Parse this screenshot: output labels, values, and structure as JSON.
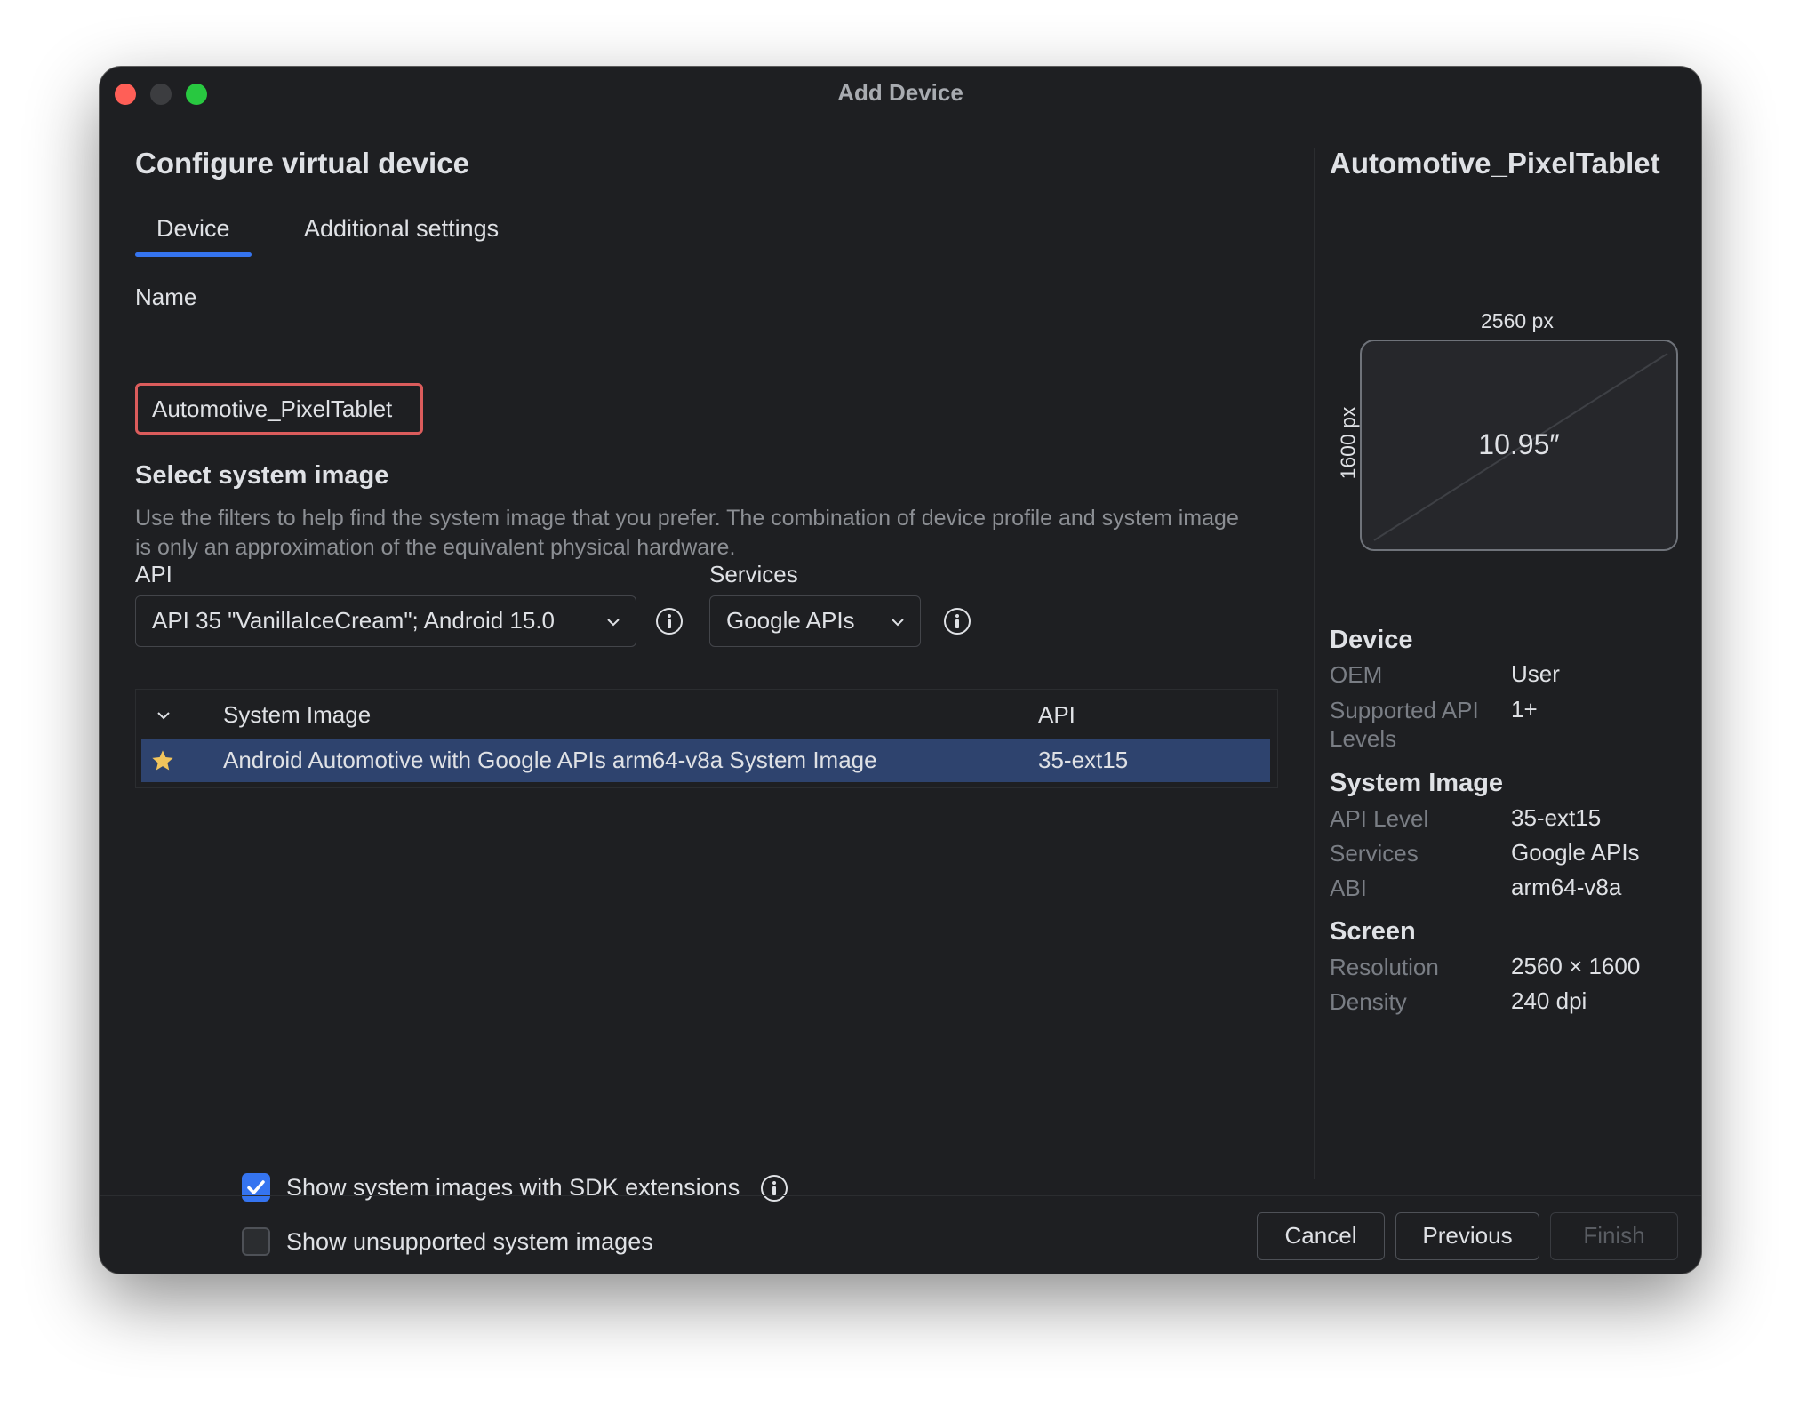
{
  "window": {
    "title": "Add Device"
  },
  "left": {
    "heading": "Configure virtual device",
    "tabs": [
      {
        "label": "Device"
      },
      {
        "label": "Additional settings"
      }
    ],
    "name_label": "Name",
    "name_value": "Automotive_PixelTablet",
    "section_title": "Select system image",
    "description": "Use the filters to help find the system image that you prefer. The combination of device profile and system image is only an approximation of the equivalent physical hardware.",
    "api_label": "API",
    "api_value": "API 35 \"VanillaIceCream\"; Android 15.0",
    "services_label": "Services",
    "services_value": "Google APIs",
    "table": {
      "columns": [
        "System Image",
        "API"
      ],
      "rows": [
        {
          "image": "Android Automotive with Google APIs arm64-v8a System Image",
          "api": "35-ext15"
        }
      ]
    },
    "checkbox_sdk": {
      "label": "Show system images with SDK extensions",
      "checked": true
    },
    "checkbox_unsupported": {
      "label": "Show unsupported system images",
      "checked": false
    }
  },
  "footer": {
    "cancel": "Cancel",
    "previous": "Previous",
    "finish": "Finish"
  },
  "right": {
    "title": "Automotive_PixelTablet",
    "preview": {
      "width_label": "2560 px",
      "height_label": "1600 px",
      "diagonal": "10.95″"
    },
    "device_heading": "Device",
    "oem_key": "OEM",
    "oem_val": "User",
    "api_levels_key": "Supported API Levels",
    "api_levels_val": "1+",
    "sysimg_heading": "System Image",
    "api_level_key": "API Level",
    "api_level_val": "35-ext15",
    "services_key": "Services",
    "services_val": "Google APIs",
    "abi_key": "ABI",
    "abi_val": "arm64-v8a",
    "screen_heading": "Screen",
    "resolution_key": "Resolution",
    "resolution_val": "2560 × 1600",
    "density_key": "Density",
    "density_val": "240 dpi"
  },
  "colors": {
    "accent": "#3574f0",
    "selected_row": "#2e436e",
    "error_border": "#db5c5c",
    "star": "#f2c55c"
  },
  "icons": [
    "info-icon",
    "chevron-down-icon",
    "star-icon",
    "checkmark-icon"
  ]
}
